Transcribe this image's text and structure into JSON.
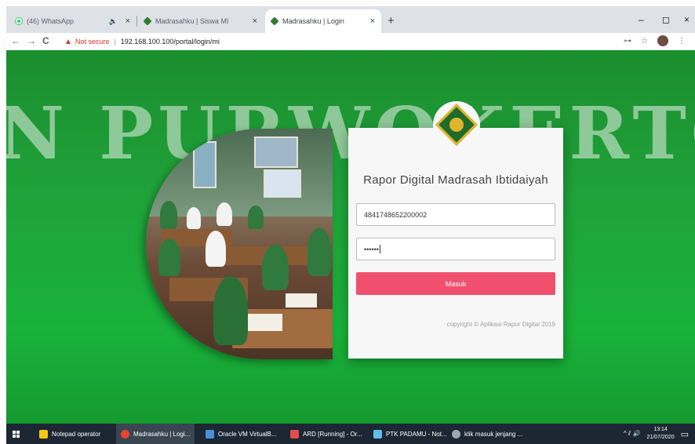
{
  "browser": {
    "tabs": [
      {
        "title": "(46) WhatsApp",
        "speaker": "🔈",
        "close": "×"
      },
      {
        "title": "Madrasahku | Siswa MI",
        "close": "×"
      },
      {
        "title": "Madrasahku | Login",
        "close": "×"
      }
    ],
    "new_tab": "+",
    "window_controls": {
      "minimize": "–",
      "maximize": "◻",
      "close": "×"
    },
    "nav": {
      "back": "←",
      "forward": "→",
      "reload": "C"
    },
    "security_label": "Not secure",
    "security_icon": "▲",
    "url": "192.168.100.100/portal/login/mi",
    "key_icon": "⊶",
    "star_icon": "☆",
    "menu_icon": "⋮"
  },
  "page": {
    "watermark": "N PURWOKERTO",
    "card": {
      "title": "Rapor Digital Madrasah Ibtidaiyah",
      "username_value": "4841748652200002",
      "password_value": "••••••",
      "submit_label": "Masuk",
      "copyright": "copyright © Aplikasi Rapor Digital 2019"
    }
  },
  "taskbar": {
    "items": [
      {
        "label": "Notepad operator",
        "color": "#f5c518"
      },
      {
        "label": "Madrasahku | Logi...",
        "color": "#e8452f"
      },
      {
        "label": "Oracle VM VirtualB...",
        "color": "#4a90d9"
      },
      {
        "label": "ARD [Running] - Or...",
        "color": "#e84b4b"
      },
      {
        "label": "PTK PADAMU - Not...",
        "color": "#5bc0eb"
      },
      {
        "label": "klik masuk jenjang ...",
        "color": "#9aa9b8"
      }
    ],
    "tray_icons": "^ ⫽ 🔊",
    "time": "13:14",
    "date": "21/07/2020",
    "notification_icon": "▭"
  }
}
